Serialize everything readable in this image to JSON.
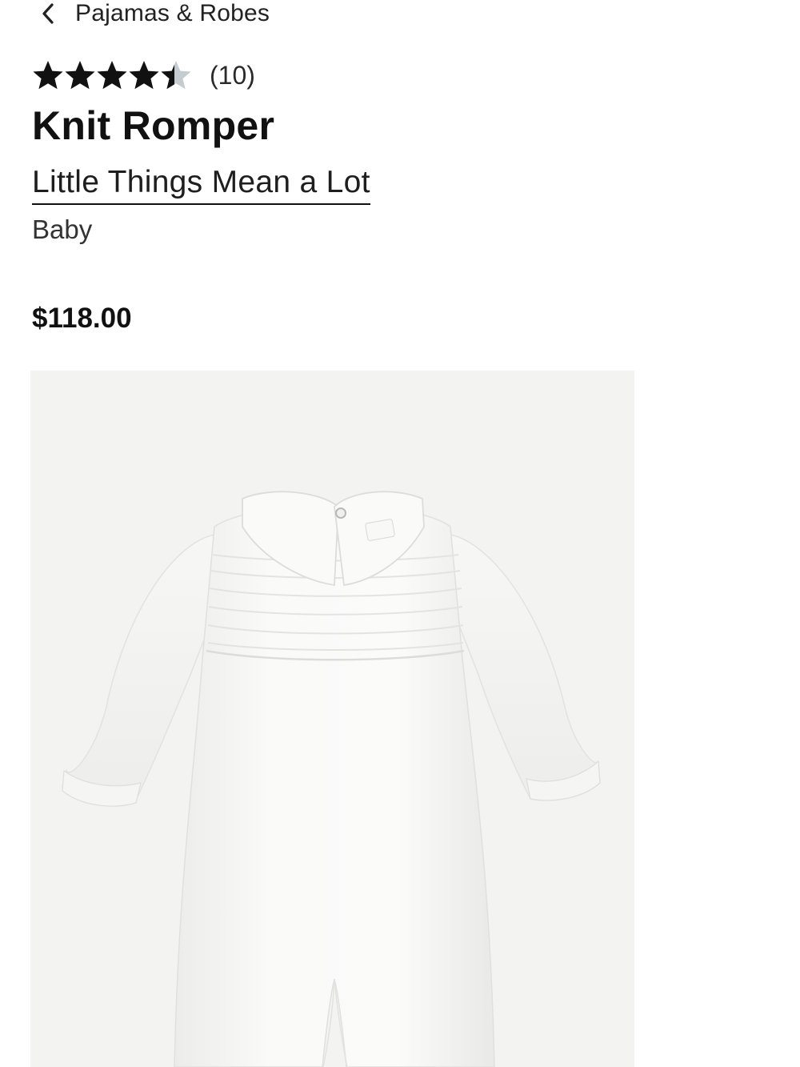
{
  "breadcrumb": {
    "icon": "chevron-left-icon",
    "label": "Pajamas & Robes"
  },
  "rating": {
    "value": 4.5,
    "max": 5,
    "count_label": "(10)",
    "filled_color": "#111111",
    "empty_color": "#c4ccd0"
  },
  "product": {
    "title": "Knit Romper",
    "brand": "Little Things Mean a Lot",
    "department": "Baby",
    "price": "$118.00",
    "image": {
      "subject": "white knit romper",
      "background_color": "#f3f3f2"
    }
  }
}
